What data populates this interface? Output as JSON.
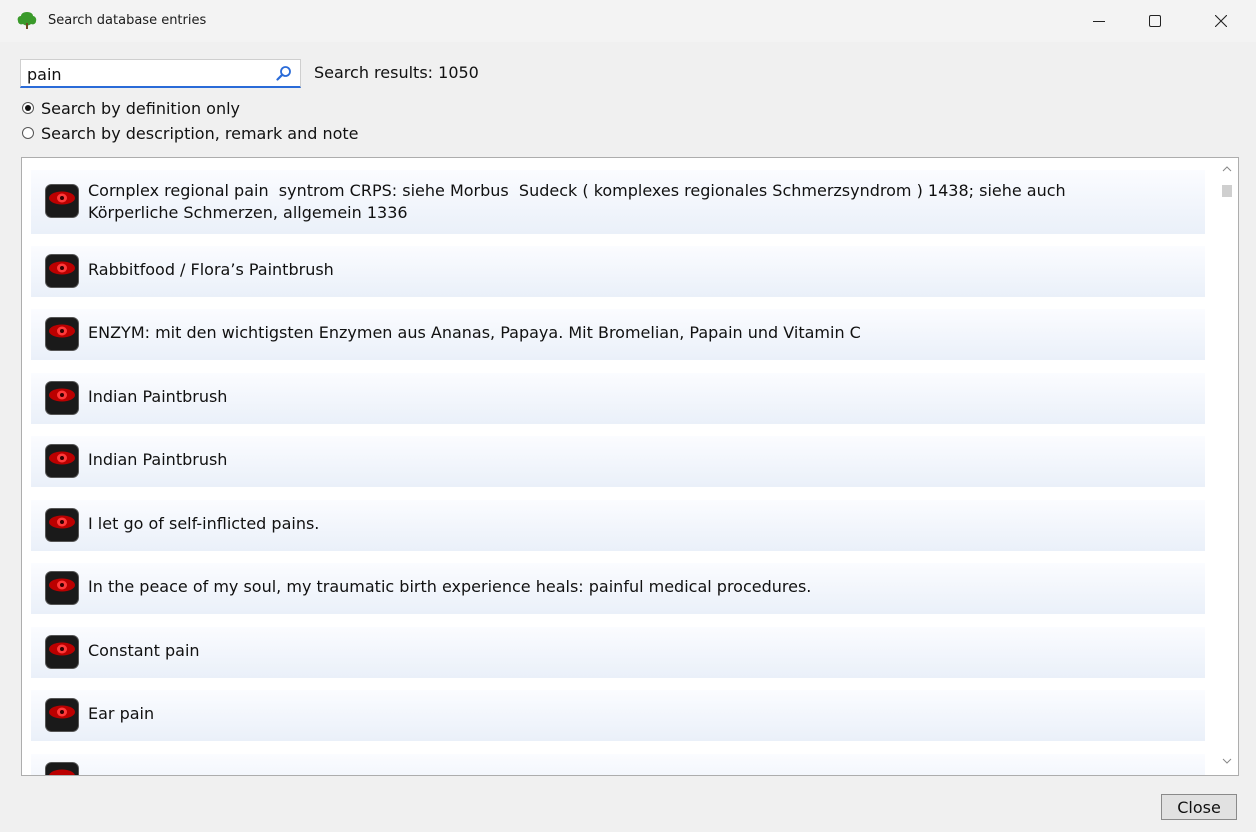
{
  "window": {
    "title": "Search database entries",
    "app_icon": "tree-icon",
    "controls": [
      "minimize-icon",
      "maximize-icon",
      "close-icon"
    ]
  },
  "search": {
    "value": "pain",
    "icon": "search-icon",
    "result_count_text": "Search results: 1050"
  },
  "options": [
    {
      "label": "Search by definition only",
      "checked": true
    },
    {
      "label": "Search by description, remark and note",
      "checked": false
    }
  ],
  "results": [
    {
      "text": "Cornplex regional pain  syntrom CRPS: siehe Morbus  Sudeck ( komplexes regionales Schmerzsyndrom ) 1438; siehe auch\nKörperliche Schmerzen, allgemein 1336",
      "icon": "eye-icon"
    },
    {
      "text": "Rabbitfood / Flora’s Paintbrush",
      "icon": "eye-icon"
    },
    {
      "text": "ENZYM: mit den wichtigsten Enzymen aus Ananas, Papaya. Mit Bromelian, Papain und Vitamin C",
      "icon": "eye-icon"
    },
    {
      "text": "Indian Paintbrush",
      "icon": "eye-icon"
    },
    {
      "text": "Indian Paintbrush",
      "icon": "eye-icon"
    },
    {
      "text": "I let go of self-inflicted pains.",
      "icon": "eye-icon"
    },
    {
      "text": "In the peace of my soul, my traumatic birth experience heals: painful medical procedures.",
      "icon": "eye-icon"
    },
    {
      "text": "Constant pain",
      "icon": "eye-icon"
    },
    {
      "text": "Ear pain",
      "icon": "eye-icon"
    }
  ],
  "footer": {
    "close_label": "Close"
  }
}
